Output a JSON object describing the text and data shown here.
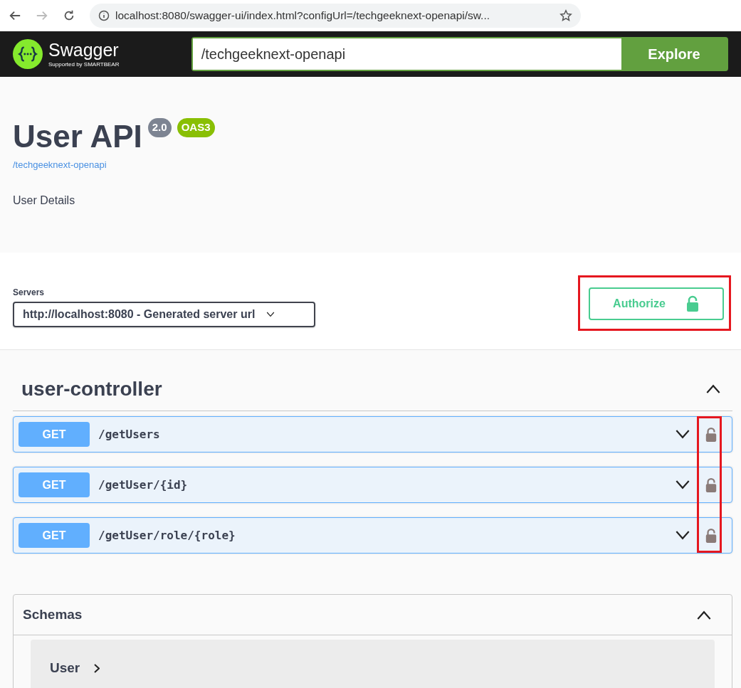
{
  "browser": {
    "url": "localhost:8080/swagger-ui/index.html?configUrl=/techgeeknext-openapi/sw..."
  },
  "topbar": {
    "logo_text": "Swagger",
    "logo_subtext": "Supported by SMARTBEAR",
    "url_value": "/techgeeknext-openapi",
    "explore_button": "Explore"
  },
  "info": {
    "title": "User API",
    "badges": [
      {
        "label": "2.0",
        "color": "#7d8492"
      },
      {
        "label": "OAS3",
        "color": "#89bf04"
      }
    ],
    "link": "/techgeeknext-openapi",
    "description": "User Details"
  },
  "servers": {
    "label": "Servers",
    "selected_server": "http://localhost:8080 - Generated server url"
  },
  "authorize_button": "Authorize",
  "tag": {
    "name": "user-controller",
    "expanded": true,
    "operations": [
      {
        "method": "GET",
        "path": "/getUsers",
        "expanded": false
      },
      {
        "method": "GET",
        "path": "/getUser/{id}",
        "expanded": false
      },
      {
        "method": "GET",
        "path": "/getUser/role/{role}",
        "expanded": false
      }
    ]
  },
  "schemas": {
    "title": "Schemas",
    "expanded": true,
    "items": [
      {
        "name": "User",
        "expanded": false
      }
    ]
  }
}
